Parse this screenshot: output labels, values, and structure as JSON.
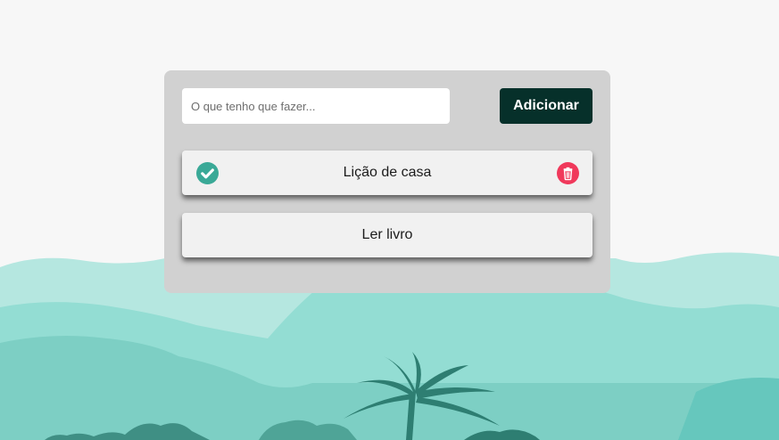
{
  "form": {
    "placeholder": "O que tenho que fazer...",
    "value": "",
    "add_label": "Adicionar"
  },
  "tasks": [
    {
      "label": "Lição de casa",
      "completed": true
    },
    {
      "label": "Ler livro",
      "completed": false
    }
  ],
  "icons": {
    "check": "check-circle-icon",
    "delete": "trash-icon"
  },
  "colors": {
    "page_bg": "#f7f7f7",
    "card_bg": "#d1d1d1",
    "button_bg": "#06302a",
    "check": "#3aa997",
    "delete": "#f0395b",
    "task_bg": "#f1f1f1"
  }
}
